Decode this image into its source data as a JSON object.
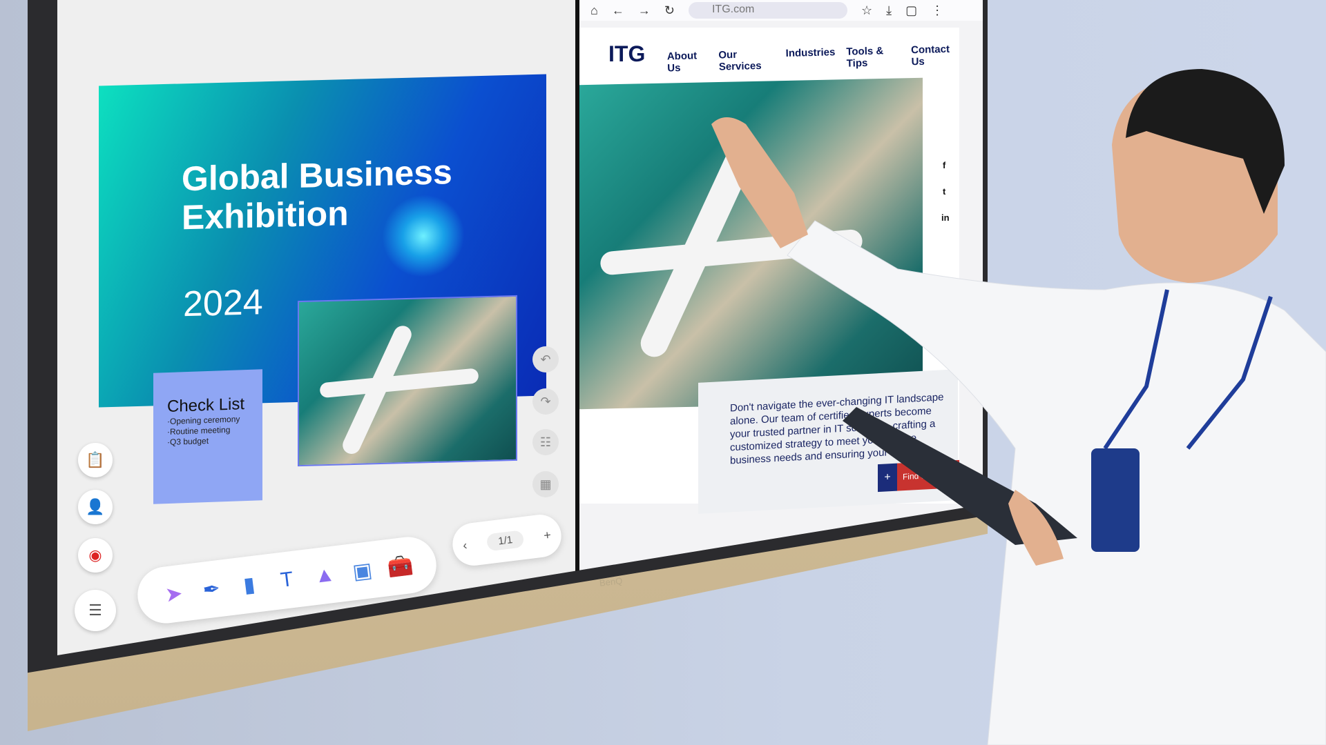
{
  "whiteboard": {
    "slide": {
      "title": "Global Business Exhibition",
      "year": "2024"
    },
    "checklist": {
      "title": "Check List",
      "items": [
        "·Opening ceremony",
        "·Routine meeting",
        "·Q3 budget"
      ]
    },
    "left_buttons": [
      "clipboard-icon",
      "add-user-icon",
      "record-icon",
      "menu-icon"
    ],
    "side_buttons": [
      "undo-icon",
      "redo-icon",
      "settings-panel-icon",
      "page-layout-icon"
    ],
    "tools": [
      "lasso-select-icon",
      "pen-icon",
      "eraser-icon",
      "text-icon",
      "shapes-icon",
      "image-icon",
      "toolbox-icon"
    ],
    "page": {
      "current": "1/1",
      "prev": "‹",
      "add": "+"
    }
  },
  "browser": {
    "url": "ITG.com",
    "site": {
      "logo": "ITG",
      "nav": [
        "About Us",
        "Our Services",
        "Industries",
        "Tools & Tips",
        "Contact Us"
      ],
      "social": [
        "f",
        "t",
        "in"
      ],
      "body": "Don't navigate the ever-changing IT landscape alone. Our team of certified experts become your trusted partner in IT solutions, crafting a customized strategy to meet your unique business needs and ensuring your success.",
      "cta_plus": "+",
      "cta": "Find out more"
    }
  },
  "device": {
    "brand": "BenQ"
  },
  "colors": {
    "navy": "#0c1a5a",
    "cta_red": "#c8332f",
    "sticky": "#8fa6f4"
  }
}
